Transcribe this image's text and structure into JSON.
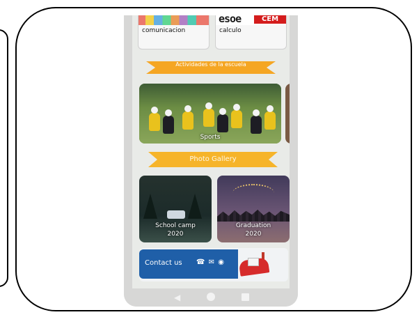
{
  "subjects": [
    {
      "label": "comunicacion",
      "thumb_text": ""
    },
    {
      "label": "calculo",
      "thumb_text": "esoe",
      "thumb_badge": "CEM"
    }
  ],
  "activities_header": "Actividades de la escuela",
  "activity_card": {
    "label": "Sports"
  },
  "gallery_header": "Photo Gallery",
  "gallery": [
    {
      "label_line1": "School camp",
      "label_line2": "2020"
    },
    {
      "label_line1": "Graduation",
      "label_line2": "2020"
    }
  ],
  "contact": {
    "label": "Contact us",
    "icons": "☎ ✉ ◉"
  },
  "colors": {
    "ribbon": "#f5a623",
    "contact": "#1f5fa8",
    "screen_bg": "#e9ebe8"
  }
}
